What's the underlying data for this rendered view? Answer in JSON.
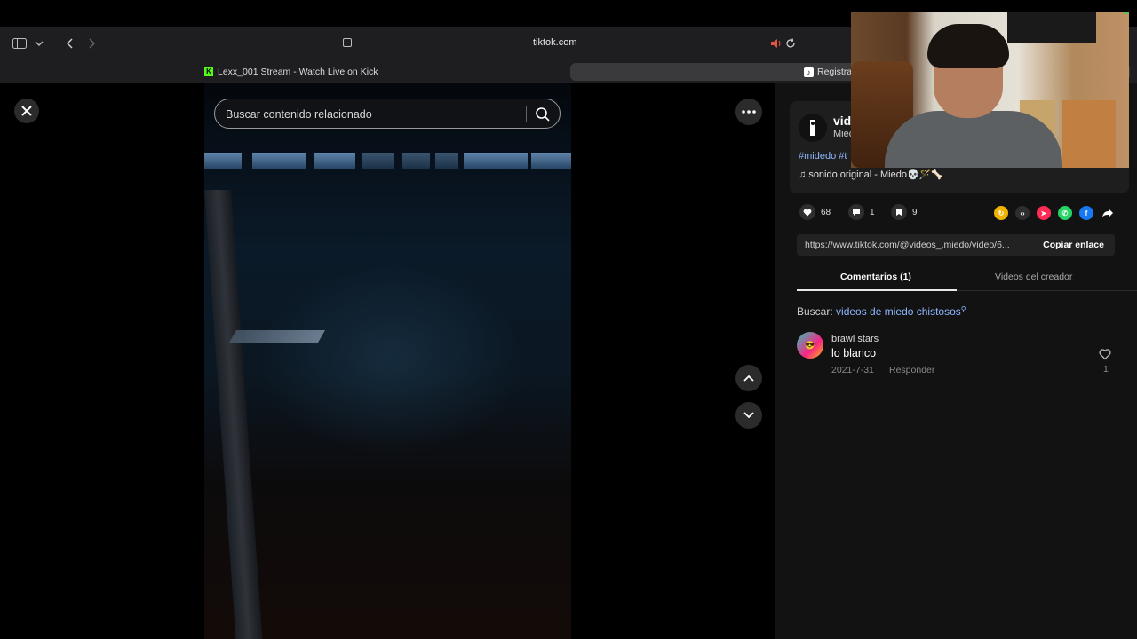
{
  "browser": {
    "url": "tiktok.com",
    "tabs": [
      {
        "label": "Lexx_001 Stream - Watch Live on Kick"
      },
      {
        "label": "Registra"
      }
    ]
  },
  "video_overlay": {
    "search_placeholder": "Buscar contenido relacionado"
  },
  "post": {
    "creator_name": "vid",
    "creator_sub": "Miec",
    "hashtags": "#midedo #t",
    "music": "sonido original - Miedo💀🪄🦴",
    "likes": "68",
    "comments_count": "1",
    "saves": "9",
    "link": "https://www.tiktok.com/@videos_.miedo/video/6...",
    "copy_label": "Copiar enlace"
  },
  "panel_tabs": [
    {
      "label": "Comentarios (1)",
      "active": true
    },
    {
      "label": "Videos del creador",
      "active": false
    }
  ],
  "search_suggestion": {
    "prefix": "Buscar:",
    "keyword": "videos de miedo chistosos"
  },
  "comments": [
    {
      "user": "brawl stars",
      "text": "lo blanco",
      "date": "2021-7-31",
      "reply_label": "Responder",
      "likes": "1"
    }
  ],
  "share_icons": [
    "repost-icon",
    "embed-icon",
    "send-icon",
    "whatsapp-icon",
    "facebook-icon",
    "share-arrow-icon"
  ],
  "colors": {
    "page_bg": "#000000",
    "panel_bg": "#121212",
    "link_blue": "#8fb7ff",
    "kick_green": "#53fc18"
  }
}
